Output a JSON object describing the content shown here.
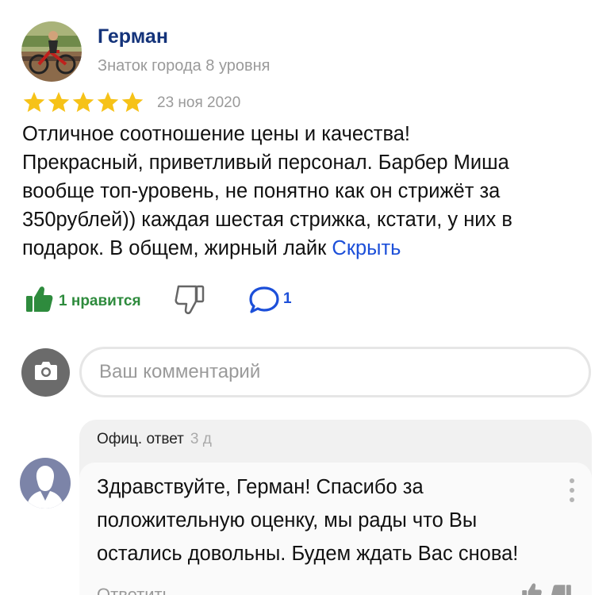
{
  "review": {
    "author_name": "Герман",
    "author_level": "Знаток города 8 уровня",
    "rating": 5,
    "date": "23 ноя 2020",
    "text_lines": [
      "Отличное соотношение цены и качества!",
      "Прекрасный, приветливый персонал. Барбер Миша",
      "вообще топ-уровень, не понятно как он стрижёт за",
      "350рублей)) каждая шестая стрижка, кстати, у них в",
      "подарок. В общем, жирный лайк"
    ],
    "hide_link": "Скрыть",
    "likes_label": "1 нравится",
    "comments_count": "1"
  },
  "comment_input": {
    "placeholder": "Ваш комментарий"
  },
  "official_reply": {
    "label": "Офиц. ответ",
    "time": "3 д",
    "text_lines": [
      "Здравствуйте, Герман! Спасибо за",
      "положительную оценку, мы рады что Вы",
      "остались довольны. Будем ждать Вас снова!"
    ],
    "reply_label": "Ответить"
  },
  "colors": {
    "name": "#14337a",
    "star": "#f6c218",
    "like": "#2e8b3d",
    "link": "#1c4fd9",
    "muted": "#9a9a9a"
  },
  "icons": {
    "like": "thumbs-up-icon",
    "dislike": "thumbs-down-icon",
    "comment": "speech-bubble-icon",
    "camera": "camera-icon",
    "more": "vertical-dots-icon"
  }
}
